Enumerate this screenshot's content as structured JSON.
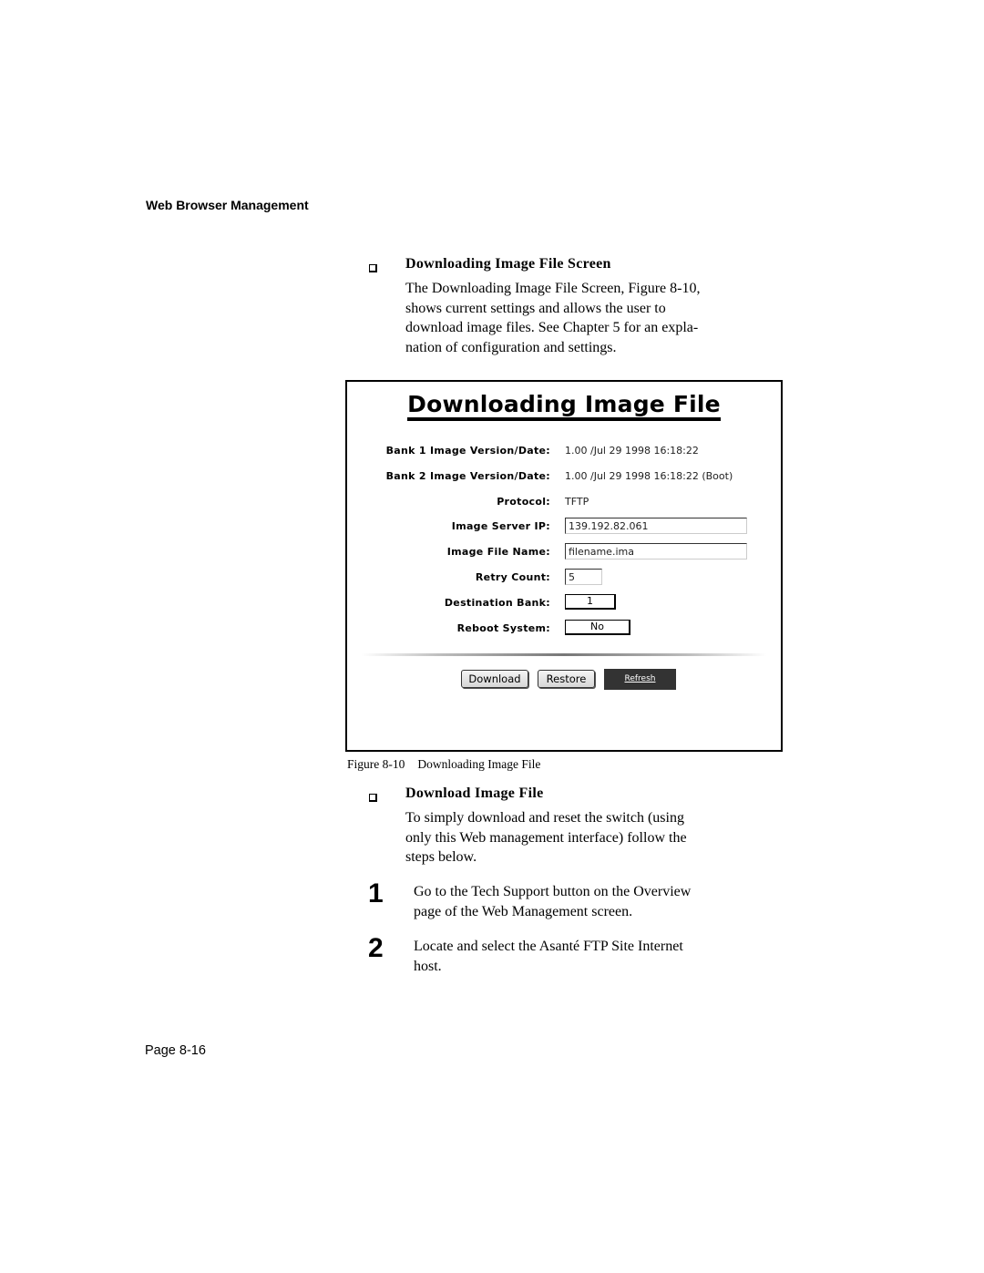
{
  "page": {
    "running_header": "Web Browser Management",
    "footer": "Page 8-16"
  },
  "section1": {
    "heading": "Downloading Image File Screen",
    "paragraph_lines": [
      "The Downloading Image File Screen, Figure 8-10,",
      "shows current settings and allows the user to",
      "download image files. See Chapter 5 for an expla-",
      "nation of configuration and settings."
    ]
  },
  "figure": {
    "title": "Downloading Image File",
    "caption_number": "Figure 8-10",
    "caption_text": "Downloading Image File",
    "fields": {
      "bank1": {
        "label": "Bank 1 Image Version/Date:",
        "value": "1.00 /Jul 29 1998 16:18:22"
      },
      "bank2": {
        "label": "Bank 2 Image Version/Date:",
        "value": "1.00 /Jul 29 1998 16:18:22 (Boot)"
      },
      "protocol": {
        "label": "Protocol:",
        "value": "TFTP"
      },
      "server_ip": {
        "label": "Image Server IP:",
        "value": "139.192.82.061"
      },
      "file_name": {
        "label": "Image File Name:",
        "value": "filename.ima"
      },
      "retry_count": {
        "label": "Retry Count:",
        "value": "5"
      },
      "dest_bank": {
        "label": "Destination Bank:",
        "value": "1"
      },
      "reboot": {
        "label": "Reboot System:",
        "value": "No"
      }
    },
    "buttons": {
      "download": "Download",
      "restore": "Restore",
      "refresh": "Refresh"
    }
  },
  "section2": {
    "heading": "Download Image File",
    "paragraph_lines": [
      "To simply download and reset the switch (using",
      "only this Web management interface) follow the",
      "steps below."
    ],
    "steps": [
      {
        "number": "1",
        "lines": [
          "Go to the Tech Support button on the Overview",
          "page of the Web Management screen."
        ]
      },
      {
        "number": "2",
        "lines": [
          "Locate and select the Asanté FTP Site Internet",
          "host."
        ]
      }
    ]
  }
}
